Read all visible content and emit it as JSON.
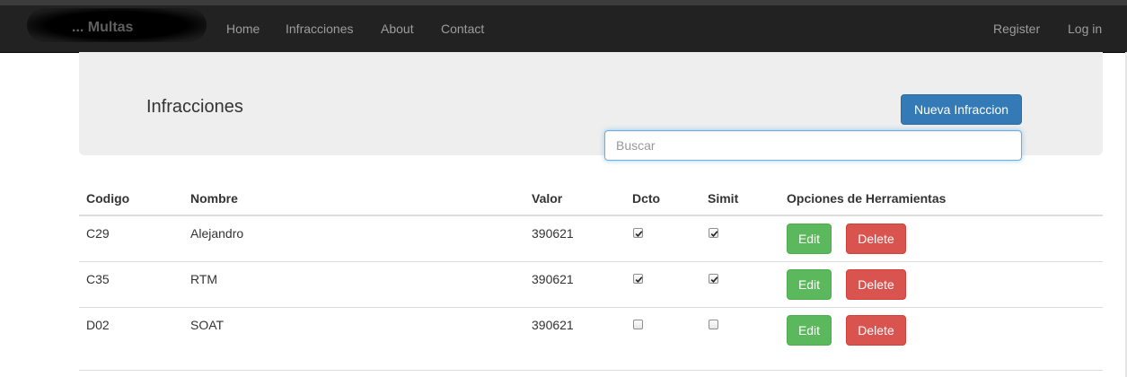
{
  "nav": {
    "brand": "... Multas",
    "links": [
      "Home",
      "Infracciones",
      "About",
      "Contact"
    ],
    "right_links": [
      "Register",
      "Log in"
    ]
  },
  "header": {
    "title": "Infracciones",
    "new_button": "Nueva Infraccion",
    "search_placeholder": "Buscar"
  },
  "table": {
    "columns": [
      "Codigo",
      "Nombre",
      "Valor",
      "Dcto",
      "Simit",
      "Opciones de Herramientas"
    ],
    "rows": [
      {
        "codigo": "C29",
        "nombre": "Alejandro",
        "valor": "390621",
        "dcto": true,
        "simit": true
      },
      {
        "codigo": "C35",
        "nombre": "RTM",
        "valor": "390621",
        "dcto": true,
        "simit": true
      },
      {
        "codigo": "D02",
        "nombre": "SOAT",
        "valor": "390621",
        "dcto": false,
        "simit": false
      }
    ],
    "edit_label": "Edit",
    "delete_label": "Delete"
  },
  "colors": {
    "navbar": "#222222",
    "primary": "#337ab7",
    "success": "#5cb85c",
    "danger": "#d9534f"
  }
}
